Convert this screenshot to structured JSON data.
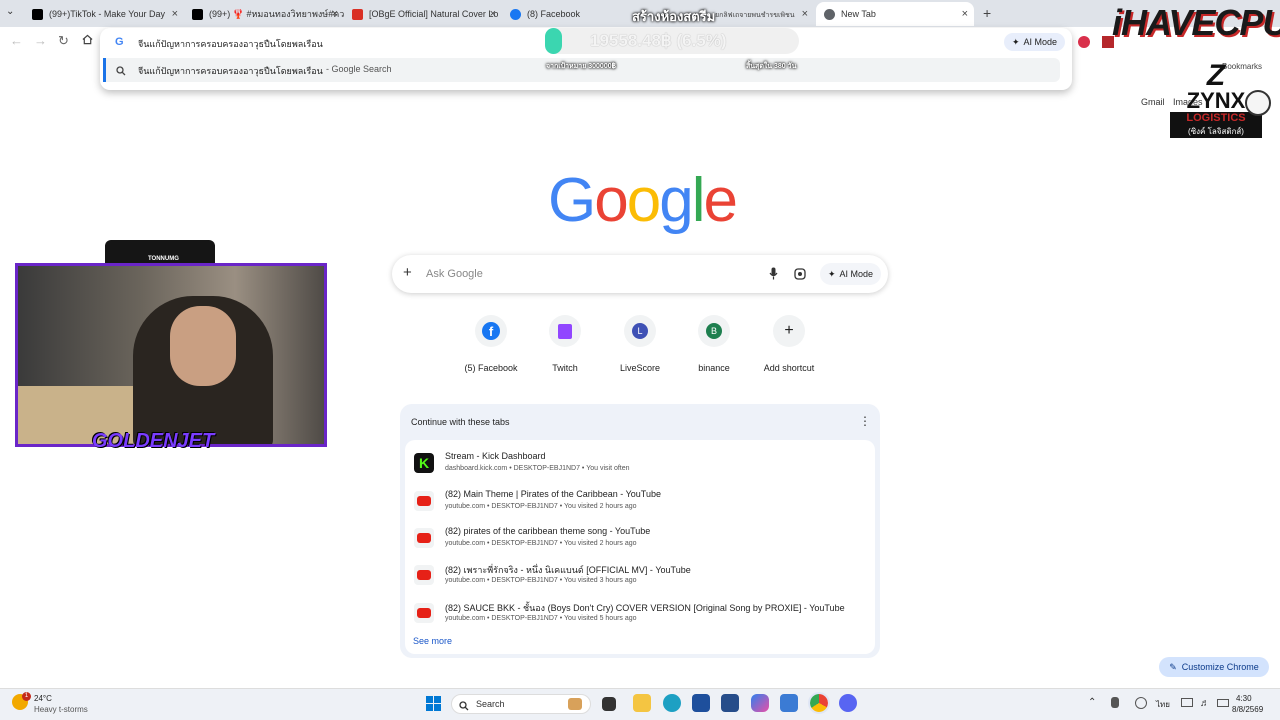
{
  "tabs": [
    {
      "title": "(99+)TikTok - Make Your Day",
      "color": "#000000"
    },
    {
      "title": "(99+) 🦞 #หมอนทองวิทยาพงษ์#ควา",
      "color": "#000000"
    },
    {
      "title": "[OBgE Official] Natural Cover Lo",
      "color": "#d93025"
    },
    {
      "title": "(8) Facebook",
      "color": "#1877f2"
    },
    {
      "title": "New Tab",
      "color": "#5f6368"
    }
  ],
  "overlay_tab_text": "สร้างห้องสตรีม",
  "overlay_tab_small": "ยกลิฟเถจายพนชำรขเพิชนราจดี",
  "omnibox": {
    "value": "จีนแก้ปัญหาการครอบครองอาวุธปืนโดยพลเรือน",
    "suggestion": "จีนแก้ปัญหาการครอบครองอาวุธปืนโดยพลเรือน",
    "suggestion_suffix": "- Google Search",
    "ai_mode": "AI Mode"
  },
  "donation_bar": {
    "amount": "19558.48฿ (6.5%)",
    "goal_label": "จากเป้าหมาย 300000฿",
    "days_left": "สิ้นสุดใน 380 วัน",
    "progress_percent": 6.5
  },
  "brand_overlay": {
    "name": "iHAVECPU",
    "sponsor": "ZYNX",
    "sponsor_sub": "LOGISTICS",
    "sponsor_thai": "(ซิงค์ โลจิสติกส์)"
  },
  "bookmarks_label": "Bookmarks",
  "top_links": {
    "gmail": "Gmail",
    "images": "Images"
  },
  "google_logo": {
    "letters": [
      "G",
      "o",
      "o",
      "g",
      "l",
      "e"
    ],
    "colors": [
      "#4285f4",
      "#ea4335",
      "#fbbc05",
      "#4285f4",
      "#34a853",
      "#ea4335"
    ]
  },
  "search": {
    "placeholder": "Ask Google",
    "ai_mode": "AI Mode"
  },
  "shortcuts": [
    {
      "label": "(5) Facebook",
      "icon": "facebook-icon",
      "letter": "f",
      "color": "#1877f2"
    },
    {
      "label": "Twitch",
      "icon": "twitch-icon",
      "letter": "t",
      "color": "#9146ff"
    },
    {
      "label": "LiveScore",
      "icon": "livescore-icon",
      "letter": "L",
      "color": "#3f51b5"
    },
    {
      "label": "binance",
      "icon": "binance-icon",
      "letter": "B",
      "color": "#1e7f4f"
    },
    {
      "label": "Add shortcut",
      "icon": "plus-icon",
      "letter": "+",
      "color": "#1f1f1f"
    }
  ],
  "continue_tabs": {
    "title": "Continue with these tabs",
    "see_more": "See more",
    "items": [
      {
        "title": "Stream - Kick Dashboard",
        "meta": "dashboard.kick.com • DESKTOP-EBJ1ND7 • You visit often",
        "icon": "kick-icon"
      },
      {
        "title": "(82) Main Theme | Pirates of the Caribbean - YouTube",
        "meta": "youtube.com • DESKTOP-EBJ1ND7 • You visited 2 hours ago",
        "icon": "youtube-icon"
      },
      {
        "title": "(82) pirates of the caribbean theme song - YouTube",
        "meta": "youtube.com • DESKTOP-EBJ1ND7 • You visited 2 hours ago",
        "icon": "youtube-icon"
      },
      {
        "title": "(82) เพราะพี่รักจริง - หนึ่ง นิเคแบนด์ [OFFICIAL MV] - YouTube",
        "meta": "youtube.com • DESKTOP-EBJ1ND7 • You visited 3 hours ago",
        "icon": "youtube-icon"
      },
      {
        "title": "(82) SAUCE BKK - ชั้นอง (Boys Don't Cry) COVER VERSION [Original Song by PROXIE] - YouTube",
        "meta": "youtube.com • DESKTOP-EBJ1ND7 • You visited 5 hours ago",
        "icon": "youtube-icon"
      }
    ]
  },
  "customize": "Customize Chrome",
  "webcam": {
    "top_label": "TONNUMG",
    "name_label": "GOLDENJET"
  },
  "taskbar": {
    "weather_temp": "24°C",
    "weather_desc": "Heavy t-storms",
    "weather_badge": "1",
    "search": "Search",
    "lang": "ไทย",
    "time": "4:30",
    "date": "8/8/2569"
  }
}
